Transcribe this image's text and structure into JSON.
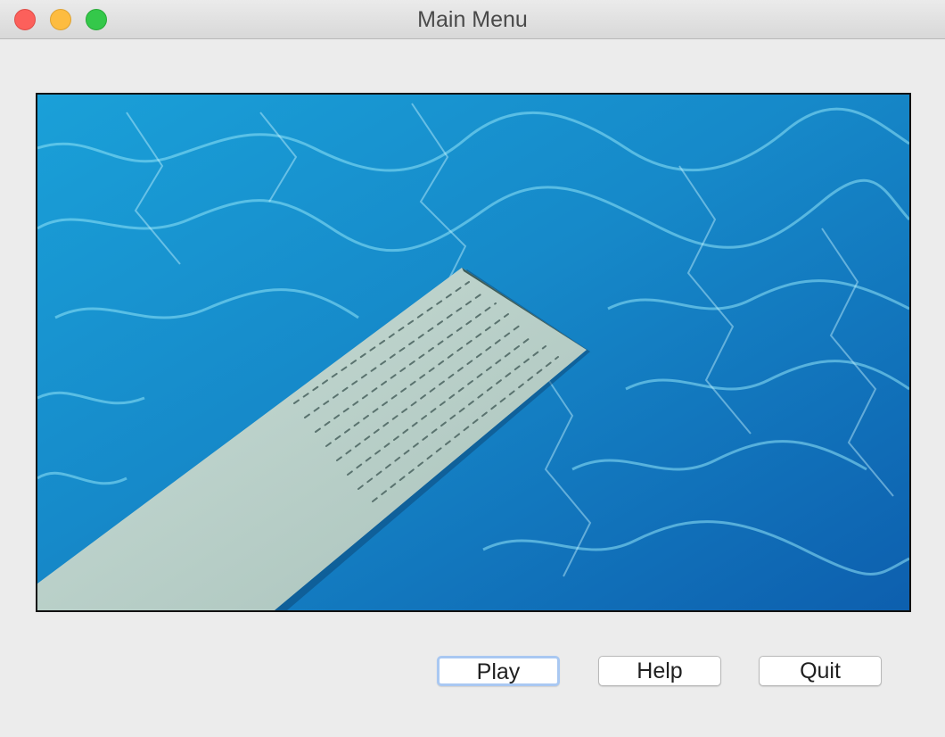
{
  "window": {
    "title": "Main Menu"
  },
  "hero_image": {
    "description_icon": "diving-board-over-pool-image"
  },
  "buttons": {
    "play_label": "Play",
    "help_label": "Help",
    "quit_label": "Quit"
  },
  "colors": {
    "focus_ring": "#a9c8f2",
    "close": "#fc605b",
    "minimize": "#fdbc40",
    "zoom": "#34c84a"
  }
}
